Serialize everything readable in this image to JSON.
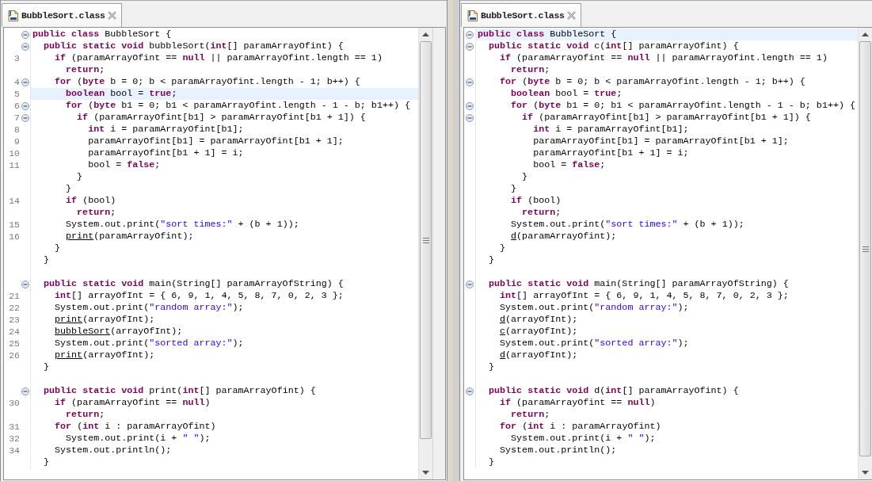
{
  "editors": [
    {
      "tab": {
        "title": "BubbleSort.class"
      },
      "lines": [
        {
          "fold": true,
          "current": false,
          "tokens": [
            {
              "kind": "keyword",
              "text": "public class"
            },
            {
              "kind": "plain",
              "text": " BubbleSort {"
            }
          ]
        },
        {
          "fold": true,
          "current": false,
          "tokens": [
            {
              "kind": "keyword",
              "text": "  public static void"
            },
            {
              "kind": "plain",
              "text": " bubbleSort("
            },
            {
              "kind": "keyword",
              "text": "int"
            },
            {
              "kind": "plain",
              "text": "[] paramArrayOfint) {"
            }
          ]
        },
        {
          "number": "3",
          "fold": false,
          "current": false,
          "tokens": [
            {
              "kind": "keyword",
              "text": "    if"
            },
            {
              "kind": "plain",
              "text": " (paramArrayOfint == "
            },
            {
              "kind": "keyword",
              "text": "null"
            },
            {
              "kind": "plain",
              "text": " || paramArrayOfint.length == 1)"
            }
          ]
        },
        {
          "fold": false,
          "current": false,
          "tokens": [
            {
              "kind": "keyword",
              "text": "      return"
            },
            {
              "kind": "plain",
              "text": ";"
            }
          ]
        },
        {
          "number": "4",
          "fold": true,
          "current": false,
          "tokens": [
            {
              "kind": "keyword",
              "text": "    for"
            },
            {
              "kind": "plain",
              "text": " ("
            },
            {
              "kind": "keyword",
              "text": "byte"
            },
            {
              "kind": "plain",
              "text": " b = 0; b < paramArrayOfint.length - 1; b++) {"
            }
          ]
        },
        {
          "number": "5",
          "fold": false,
          "current": true,
          "tokens": [
            {
              "kind": "keyword",
              "text": "      boolean"
            },
            {
              "kind": "plain",
              "text": " bool = "
            },
            {
              "kind": "keyword",
              "text": "true"
            },
            {
              "kind": "plain",
              "text": ";"
            }
          ]
        },
        {
          "number": "6",
          "fold": true,
          "current": false,
          "tokens": [
            {
              "kind": "keyword",
              "text": "      for"
            },
            {
              "kind": "plain",
              "text": " ("
            },
            {
              "kind": "keyword",
              "text": "byte"
            },
            {
              "kind": "plain",
              "text": " b1 = 0; b1 < paramArrayOfint.length - 1 - b; b1++) {"
            }
          ]
        },
        {
          "number": "7",
          "fold": true,
          "current": false,
          "tokens": [
            {
              "kind": "keyword",
              "text": "        if"
            },
            {
              "kind": "plain",
              "text": " (paramArrayOfint[b1] > paramArrayOfint[b1 + 1]) {"
            }
          ]
        },
        {
          "number": "8",
          "fold": false,
          "current": false,
          "tokens": [
            {
              "kind": "keyword",
              "text": "          int"
            },
            {
              "kind": "plain",
              "text": " i = paramArrayOfint[b1];"
            }
          ]
        },
        {
          "number": "9",
          "fold": false,
          "current": false,
          "tokens": [
            {
              "kind": "plain",
              "text": "          paramArrayOfint[b1] = paramArrayOfint[b1 + 1];"
            }
          ]
        },
        {
          "number": "10",
          "fold": false,
          "current": false,
          "tokens": [
            {
              "kind": "plain",
              "text": "          paramArrayOfint[b1 + 1] = i;"
            }
          ]
        },
        {
          "number": "11",
          "fold": false,
          "current": false,
          "tokens": [
            {
              "kind": "plain",
              "text": "          bool = "
            },
            {
              "kind": "keyword",
              "text": "false"
            },
            {
              "kind": "plain",
              "text": ";"
            }
          ]
        },
        {
          "fold": false,
          "current": false,
          "tokens": [
            {
              "kind": "plain",
              "text": "        }"
            }
          ]
        },
        {
          "fold": false,
          "current": false,
          "tokens": [
            {
              "kind": "plain",
              "text": "      }"
            }
          ]
        },
        {
          "number": "14",
          "fold": false,
          "current": false,
          "tokens": [
            {
              "kind": "keyword",
              "text": "      if"
            },
            {
              "kind": "plain",
              "text": " (bool)"
            }
          ]
        },
        {
          "fold": false,
          "current": false,
          "tokens": [
            {
              "kind": "keyword",
              "text": "        return"
            },
            {
              "kind": "plain",
              "text": ";"
            }
          ]
        },
        {
          "number": "15",
          "fold": false,
          "current": false,
          "tokens": [
            {
              "kind": "plain",
              "text": "      System.out.print("
            },
            {
              "kind": "string",
              "text": "\"sort times:\""
            },
            {
              "kind": "plain",
              "text": " + (b + 1));"
            }
          ]
        },
        {
          "number": "16",
          "fold": false,
          "current": false,
          "tokens": [
            {
              "kind": "call",
              "text": "      print"
            },
            {
              "kind": "plain",
              "text": "(paramArrayOfint);"
            }
          ]
        },
        {
          "fold": false,
          "current": false,
          "tokens": [
            {
              "kind": "plain",
              "text": "    }"
            }
          ]
        },
        {
          "fold": false,
          "current": false,
          "tokens": [
            {
              "kind": "plain",
              "text": "  }"
            }
          ]
        },
        {
          "fold": false,
          "current": false
        },
        {
          "fold": true,
          "current": false,
          "tokens": [
            {
              "kind": "keyword",
              "text": "  public static void"
            },
            {
              "kind": "plain",
              "text": " main(String[] paramArrayOfString) {"
            }
          ]
        },
        {
          "number": "21",
          "fold": false,
          "current": false,
          "tokens": [
            {
              "kind": "keyword",
              "text": "    int"
            },
            {
              "kind": "plain",
              "text": "[] arrayOfInt = { 6, 9, 1, 4, 5, 8, 7, 0, 2, 3 };"
            }
          ]
        },
        {
          "number": "22",
          "fold": false,
          "current": false,
          "tokens": [
            {
              "kind": "plain",
              "text": "    System.out.print("
            },
            {
              "kind": "string",
              "text": "\"random array:\""
            },
            {
              "kind": "plain",
              "text": ");"
            }
          ]
        },
        {
          "number": "23",
          "fold": false,
          "current": false,
          "tokens": [
            {
              "kind": "call",
              "text": "    print"
            },
            {
              "kind": "plain",
              "text": "(arrayOfInt);"
            }
          ]
        },
        {
          "number": "24",
          "fold": false,
          "current": false,
          "tokens": [
            {
              "kind": "call",
              "text": "    bubbleSort"
            },
            {
              "kind": "plain",
              "text": "(arrayOfInt);"
            }
          ]
        },
        {
          "number": "25",
          "fold": false,
          "current": false,
          "tokens": [
            {
              "kind": "plain",
              "text": "    System.out.print("
            },
            {
              "kind": "string",
              "text": "\"sorted array:\""
            },
            {
              "kind": "plain",
              "text": ");"
            }
          ]
        },
        {
          "number": "26",
          "fold": false,
          "current": false,
          "tokens": [
            {
              "kind": "call",
              "text": "    print"
            },
            {
              "kind": "plain",
              "text": "(arrayOfInt);"
            }
          ]
        },
        {
          "fold": false,
          "current": false,
          "tokens": [
            {
              "kind": "plain",
              "text": "  }"
            }
          ]
        },
        {
          "fold": false,
          "current": false
        },
        {
          "fold": true,
          "current": false,
          "tokens": [
            {
              "kind": "keyword",
              "text": "  public static void"
            },
            {
              "kind": "plain",
              "text": " print("
            },
            {
              "kind": "keyword",
              "text": "int"
            },
            {
              "kind": "plain",
              "text": "[] paramArrayOfint) {"
            }
          ]
        },
        {
          "number": "30",
          "fold": false,
          "current": false,
          "tokens": [
            {
              "kind": "keyword",
              "text": "    if"
            },
            {
              "kind": "plain",
              "text": " (paramArrayOfint == "
            },
            {
              "kind": "keyword",
              "text": "null"
            },
            {
              "kind": "plain",
              "text": ")"
            }
          ]
        },
        {
          "fold": false,
          "current": false,
          "tokens": [
            {
              "kind": "keyword",
              "text": "      return"
            },
            {
              "kind": "plain",
              "text": ";"
            }
          ]
        },
        {
          "number": "31",
          "fold": false,
          "current": false,
          "tokens": [
            {
              "kind": "keyword",
              "text": "    for"
            },
            {
              "kind": "plain",
              "text": " ("
            },
            {
              "kind": "keyword",
              "text": "int"
            },
            {
              "kind": "plain",
              "text": " i : paramArrayOfint)"
            }
          ]
        },
        {
          "number": "32",
          "fold": false,
          "current": false,
          "tokens": [
            {
              "kind": "plain",
              "text": "      System.out.print(i + "
            },
            {
              "kind": "string",
              "text": "\" \""
            },
            {
              "kind": "plain",
              "text": ");"
            }
          ]
        },
        {
          "number": "34",
          "fold": false,
          "current": false,
          "tokens": [
            {
              "kind": "plain",
              "text": "    System.out.println();"
            }
          ]
        },
        {
          "fold": false,
          "current": false,
          "tokens": [
            {
              "kind": "plain",
              "text": "  }"
            }
          ]
        }
      ]
    },
    {
      "tab": {
        "title": "BubbleSort.class"
      },
      "lines": [
        {
          "fold": true,
          "current": true,
          "tokens": [
            {
              "kind": "keyword",
              "text": "public class"
            },
            {
              "kind": "plain",
              "text": " BubbleSort {"
            }
          ]
        },
        {
          "fold": true,
          "current": false,
          "tokens": [
            {
              "kind": "keyword",
              "text": "  public static void"
            },
            {
              "kind": "plain",
              "text": " c("
            },
            {
              "kind": "keyword",
              "text": "int"
            },
            {
              "kind": "plain",
              "text": "[] paramArrayOfint) {"
            }
          ]
        },
        {
          "fold": false,
          "current": false,
          "tokens": [
            {
              "kind": "keyword",
              "text": "    if"
            },
            {
              "kind": "plain",
              "text": " (paramArrayOfint == "
            },
            {
              "kind": "keyword",
              "text": "null"
            },
            {
              "kind": "plain",
              "text": " || paramArrayOfint.length == 1)"
            }
          ]
        },
        {
          "fold": false,
          "current": false,
          "tokens": [
            {
              "kind": "keyword",
              "text": "      return"
            },
            {
              "kind": "plain",
              "text": ";"
            }
          ]
        },
        {
          "fold": true,
          "current": false,
          "tokens": [
            {
              "kind": "keyword",
              "text": "    for"
            },
            {
              "kind": "plain",
              "text": " ("
            },
            {
              "kind": "keyword",
              "text": "byte"
            },
            {
              "kind": "plain",
              "text": " b = 0; b < paramArrayOfint.length - 1; b++) {"
            }
          ]
        },
        {
          "fold": false,
          "current": false,
          "tokens": [
            {
              "kind": "keyword",
              "text": "      boolean"
            },
            {
              "kind": "plain",
              "text": " bool = "
            },
            {
              "kind": "keyword",
              "text": "true"
            },
            {
              "kind": "plain",
              "text": ";"
            }
          ]
        },
        {
          "fold": true,
          "current": false,
          "tokens": [
            {
              "kind": "keyword",
              "text": "      for"
            },
            {
              "kind": "plain",
              "text": " ("
            },
            {
              "kind": "keyword",
              "text": "byte"
            },
            {
              "kind": "plain",
              "text": " b1 = 0; b1 < paramArrayOfint.length - 1 - b; b1++) {"
            }
          ]
        },
        {
          "fold": true,
          "current": false,
          "tokens": [
            {
              "kind": "keyword",
              "text": "        if"
            },
            {
              "kind": "plain",
              "text": " (paramArrayOfint[b1] > paramArrayOfint[b1 + 1]) {"
            }
          ]
        },
        {
          "fold": false,
          "current": false,
          "tokens": [
            {
              "kind": "keyword",
              "text": "          int"
            },
            {
              "kind": "plain",
              "text": " i = paramArrayOfint[b1];"
            }
          ]
        },
        {
          "fold": false,
          "current": false,
          "tokens": [
            {
              "kind": "plain",
              "text": "          paramArrayOfint[b1] = paramArrayOfint[b1 + 1];"
            }
          ]
        },
        {
          "fold": false,
          "current": false,
          "tokens": [
            {
              "kind": "plain",
              "text": "          paramArrayOfint[b1 + 1] = i;"
            }
          ]
        },
        {
          "fold": false,
          "current": false,
          "tokens": [
            {
              "kind": "plain",
              "text": "          bool = "
            },
            {
              "kind": "keyword",
              "text": "false"
            },
            {
              "kind": "plain",
              "text": ";"
            }
          ]
        },
        {
          "fold": false,
          "current": false,
          "tokens": [
            {
              "kind": "plain",
              "text": "        }"
            }
          ]
        },
        {
          "fold": false,
          "current": false,
          "tokens": [
            {
              "kind": "plain",
              "text": "      }"
            }
          ]
        },
        {
          "fold": false,
          "current": false,
          "tokens": [
            {
              "kind": "keyword",
              "text": "      if"
            },
            {
              "kind": "plain",
              "text": " (bool)"
            }
          ]
        },
        {
          "fold": false,
          "current": false,
          "tokens": [
            {
              "kind": "keyword",
              "text": "        return"
            },
            {
              "kind": "plain",
              "text": ";"
            }
          ]
        },
        {
          "fold": false,
          "current": false,
          "tokens": [
            {
              "kind": "plain",
              "text": "      System.out.print("
            },
            {
              "kind": "string",
              "text": "\"sort times:\""
            },
            {
              "kind": "plain",
              "text": " + (b + 1));"
            }
          ]
        },
        {
          "fold": false,
          "current": false,
          "tokens": [
            {
              "kind": "call",
              "text": "      d"
            },
            {
              "kind": "plain",
              "text": "(paramArrayOfint);"
            }
          ]
        },
        {
          "fold": false,
          "current": false,
          "tokens": [
            {
              "kind": "plain",
              "text": "    }"
            }
          ]
        },
        {
          "fold": false,
          "current": false,
          "tokens": [
            {
              "kind": "plain",
              "text": "  }"
            }
          ]
        },
        {
          "fold": false,
          "current": false
        },
        {
          "fold": true,
          "current": false,
          "tokens": [
            {
              "kind": "keyword",
              "text": "  public static void"
            },
            {
              "kind": "plain",
              "text": " main(String[] paramArrayOfString) {"
            }
          ]
        },
        {
          "fold": false,
          "current": false,
          "tokens": [
            {
              "kind": "keyword",
              "text": "    int"
            },
            {
              "kind": "plain",
              "text": "[] arrayOfInt = { 6, 9, 1, 4, 5, 8, 7, 0, 2, 3 };"
            }
          ]
        },
        {
          "fold": false,
          "current": false,
          "tokens": [
            {
              "kind": "plain",
              "text": "    System.out.print("
            },
            {
              "kind": "string",
              "text": "\"random array:\""
            },
            {
              "kind": "plain",
              "text": ");"
            }
          ]
        },
        {
          "fold": false,
          "current": false,
          "tokens": [
            {
              "kind": "call",
              "text": "    d"
            },
            {
              "kind": "plain",
              "text": "(arrayOfInt);"
            }
          ]
        },
        {
          "fold": false,
          "current": false,
          "tokens": [
            {
              "kind": "call",
              "text": "    c"
            },
            {
              "kind": "plain",
              "text": "(arrayOfInt);"
            }
          ]
        },
        {
          "fold": false,
          "current": false,
          "tokens": [
            {
              "kind": "plain",
              "text": "    System.out.print("
            },
            {
              "kind": "string",
              "text": "\"sorted array:\""
            },
            {
              "kind": "plain",
              "text": ");"
            }
          ]
        },
        {
          "fold": false,
          "current": false,
          "tokens": [
            {
              "kind": "call",
              "text": "    d"
            },
            {
              "kind": "plain",
              "text": "(arrayOfInt);"
            }
          ]
        },
        {
          "fold": false,
          "current": false,
          "tokens": [
            {
              "kind": "plain",
              "text": "  }"
            }
          ]
        },
        {
          "fold": false,
          "current": false
        },
        {
          "fold": true,
          "current": false,
          "tokens": [
            {
              "kind": "keyword",
              "text": "  public static void"
            },
            {
              "kind": "plain",
              "text": " d("
            },
            {
              "kind": "keyword",
              "text": "int"
            },
            {
              "kind": "plain",
              "text": "[] paramArrayOfint) {"
            }
          ]
        },
        {
          "fold": false,
          "current": false,
          "tokens": [
            {
              "kind": "keyword",
              "text": "    if"
            },
            {
              "kind": "plain",
              "text": " (paramArrayOfint == "
            },
            {
              "kind": "keyword",
              "text": "null"
            },
            {
              "kind": "plain",
              "text": ")"
            }
          ]
        },
        {
          "fold": false,
          "current": false,
          "tokens": [
            {
              "kind": "keyword",
              "text": "      return"
            },
            {
              "kind": "plain",
              "text": ";"
            }
          ]
        },
        {
          "fold": false,
          "current": false,
          "tokens": [
            {
              "kind": "keyword",
              "text": "    for"
            },
            {
              "kind": "plain",
              "text": " ("
            },
            {
              "kind": "keyword",
              "text": "int"
            },
            {
              "kind": "plain",
              "text": " i : paramArrayOfint)"
            }
          ]
        },
        {
          "fold": false,
          "current": false,
          "tokens": [
            {
              "kind": "plain",
              "text": "      System.out.print(i + "
            },
            {
              "kind": "string",
              "text": "\" \""
            },
            {
              "kind": "plain",
              "text": ");"
            }
          ]
        },
        {
          "fold": false,
          "current": false,
          "tokens": [
            {
              "kind": "plain",
              "text": "    System.out.println();"
            }
          ]
        },
        {
          "fold": false,
          "current": false,
          "tokens": [
            {
              "kind": "plain",
              "text": "  }"
            }
          ]
        }
      ]
    }
  ]
}
